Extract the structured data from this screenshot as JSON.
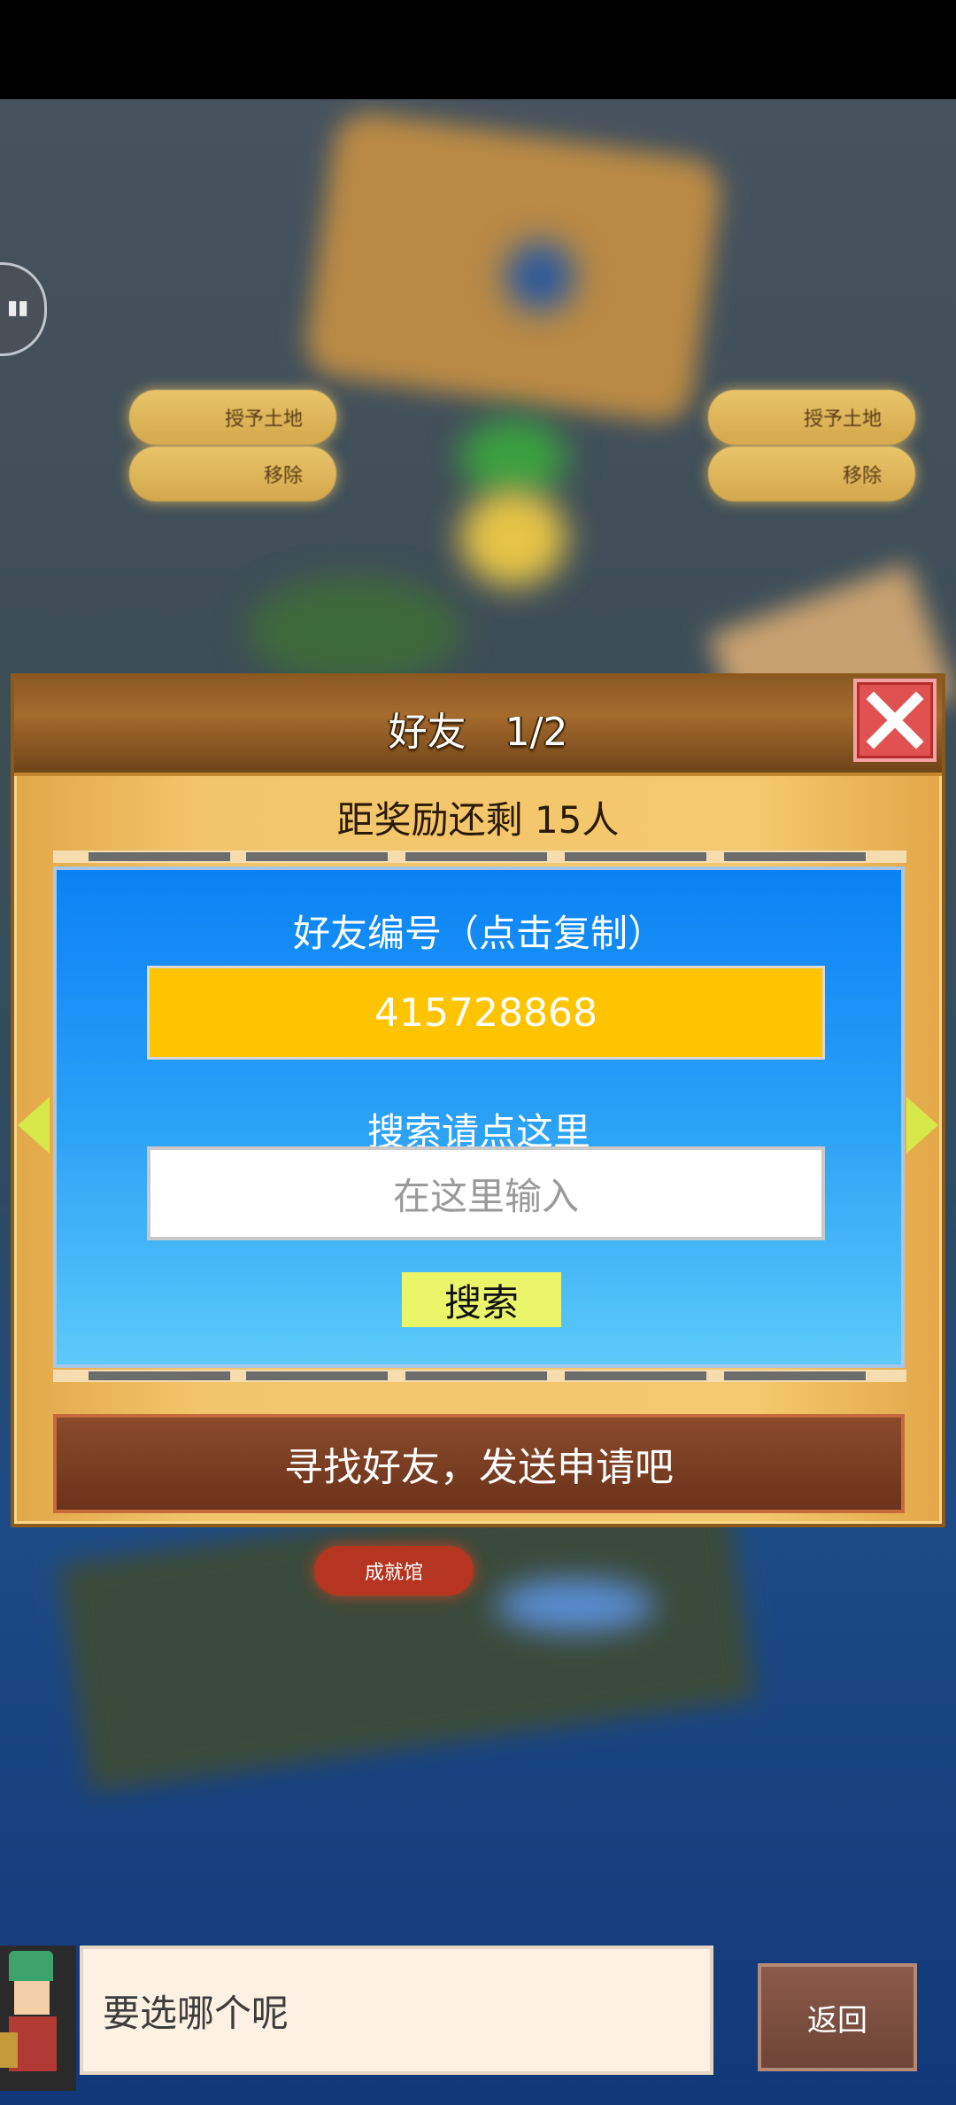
{
  "background": {
    "buttons": [
      {
        "label": "授予土地"
      },
      {
        "label": "移除"
      },
      {
        "label": "授予土地"
      },
      {
        "label": "移除"
      }
    ],
    "achievement_label": "成就馆"
  },
  "dialog": {
    "title": "好友　1/2",
    "reward_text": "距奖励还剩 15人",
    "id_label": "好友编号（点击复制）",
    "id_value": "415728868",
    "search_label": "搜索请点这里",
    "search_placeholder": "在这里输入",
    "search_button": "搜索",
    "cta_button": "寻找好友，发送申请吧"
  },
  "bottom": {
    "speech_text": "要选哪个呢",
    "back_button": "返回"
  },
  "colors": {
    "dialog_frame": "#f2c56a",
    "header": "#8c5a24",
    "close": "#e05252",
    "panel_blue": "#0a82f5",
    "id_box": "#ffc400",
    "search_button": "#eaf56a",
    "cta": "#7a3f24"
  },
  "icons": [
    "chat-bubble-icon",
    "close-icon",
    "arrow-left-icon",
    "arrow-right-icon"
  ]
}
